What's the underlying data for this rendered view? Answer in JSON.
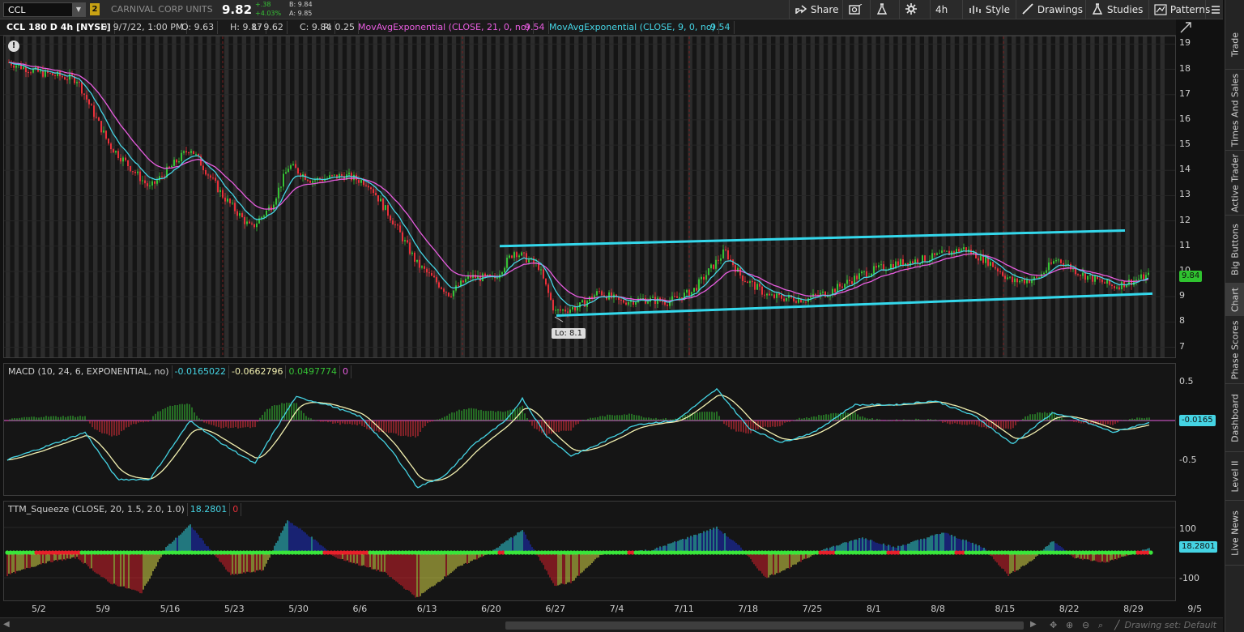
{
  "toolbar": {
    "symbol": "CCL",
    "link_badge": "2",
    "company": "CARNIVAL CORP UNITS",
    "last": "9.82",
    "net_change": "+.38",
    "pct_change": "+4.03%",
    "bid": "B: 9.84",
    "ask": "A: 9.85",
    "share_label": "Share",
    "aggregation_label": "4h",
    "style_label": "Style",
    "drawings_label": "Drawings",
    "studies_label": "Studies",
    "patterns_label": "Patterns"
  },
  "info": {
    "symbol_desc": "CCL 180 D 4h [NYSE]",
    "date": "D: 9/7/22, 1:00 PM",
    "open": "O: 9.63",
    "high": "H: 9.87",
    "low": "L: 9.62",
    "close": "C: 9.84",
    "range": "R: 0.25",
    "ema21_label": "MovAvgExponential (CLOSE, 21, 0, no)",
    "ema21_value": "9.54",
    "ema9_label": "MovAvgExponential (CLOSE, 9, 0, no)",
    "ema9_value": "9.54"
  },
  "price_axis": {
    "ticks": [
      "19",
      "18",
      "17",
      "16",
      "15",
      "14",
      "13",
      "12",
      "11",
      "10",
      "9",
      "8",
      "7"
    ],
    "last_pill": "9.84",
    "low_callout": "Lo: 8.1"
  },
  "macd": {
    "label": "MACD (10, 24, 6, EXPONENTIAL, no)",
    "value": "-0.0165022",
    "avg": "-0.0662796",
    "diff": "0.0497774",
    "zero": "0",
    "ticks": [
      "0.5",
      "-0.5"
    ],
    "pill": "-0.0165"
  },
  "ttm": {
    "label": "TTM_Squeeze (CLOSE, 20, 1.5, 2.0, 1.0)",
    "value": "18.2801",
    "flag": "0",
    "ticks": [
      "100",
      "0",
      "-100"
    ],
    "pill": "18.2801"
  },
  "dates": [
    "5/2",
    "5/9",
    "5/16",
    "5/23",
    "5/30",
    "6/6",
    "6/13",
    "6/20",
    "6/27",
    "7/4",
    "7/11",
    "7/18",
    "7/25",
    "8/1",
    "8/8",
    "8/15",
    "8/22",
    "8/29",
    "9/5"
  ],
  "drawing_set": "Drawing set: Default",
  "right_tabs": [
    "Trade",
    "Times And Sales",
    "Active Trader",
    "Big Buttons",
    "Chart",
    "Phase Scores",
    "Dashboard",
    "Level II",
    "Live News"
  ],
  "colors": {
    "up": "#36c235",
    "down": "#e8303a",
    "ema21": "#e85de0",
    "ema9": "#45d4e4",
    "channel": "#34d8ec",
    "macd_avg": "#f2f0b0",
    "squeeze_on": "#e8202a",
    "squeeze_off": "#39e63a"
  }
}
